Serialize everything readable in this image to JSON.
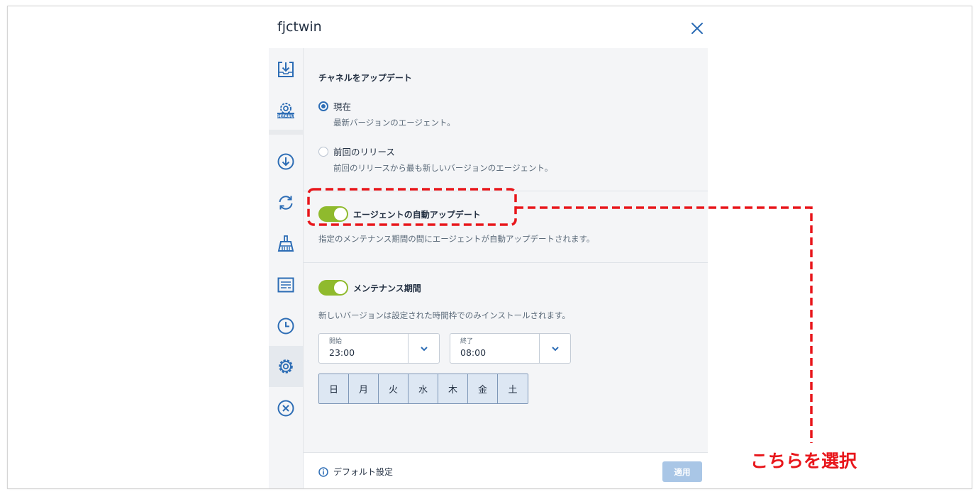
{
  "dialog": {
    "title": "fjctwin"
  },
  "sidebar": {
    "items": [
      {
        "icon": "download-box-icon"
      },
      {
        "icon": "gear-default-icon"
      },
      {
        "icon": "download-circle-icon"
      },
      {
        "icon": "sync-icon"
      },
      {
        "icon": "broom-icon"
      },
      {
        "icon": "report-icon"
      },
      {
        "icon": "clock-icon"
      },
      {
        "icon": "gear-icon",
        "active": true
      },
      {
        "icon": "close-circle-icon"
      }
    ],
    "default_badge": "DEFAULT"
  },
  "update_channel": {
    "title": "チャネルをアップデート",
    "options": [
      {
        "label": "現在",
        "description": "最新バージョンのエージェント。",
        "checked": true
      },
      {
        "label": "前回のリリース",
        "description": "前回のリリースから最も新しいバージョンのエージェント。",
        "checked": false
      }
    ]
  },
  "auto_update": {
    "label": "エージェントの自動アップデート",
    "enabled": true,
    "description": "指定のメンテナンス期間の間にエージェントが自動アップデートされます。"
  },
  "maintenance": {
    "label": "メンテナンス期間",
    "enabled": true,
    "description": "新しいバージョンは設定された時間枠でのみインストールされます。",
    "start": {
      "label": "開始",
      "value": "23:00"
    },
    "end": {
      "label": "終了",
      "value": "08:00"
    },
    "days": [
      "日",
      "月",
      "火",
      "水",
      "木",
      "金",
      "土"
    ]
  },
  "footer": {
    "default_settings_label": "デフォルト設定",
    "apply_label": "適用"
  },
  "annotation": {
    "text": "こちらを選択",
    "color": "#e8161b"
  },
  "colors": {
    "accent": "#2d6db5",
    "toggle_on": "#8fba2d",
    "apply_disabled": "#a9c6e6"
  }
}
